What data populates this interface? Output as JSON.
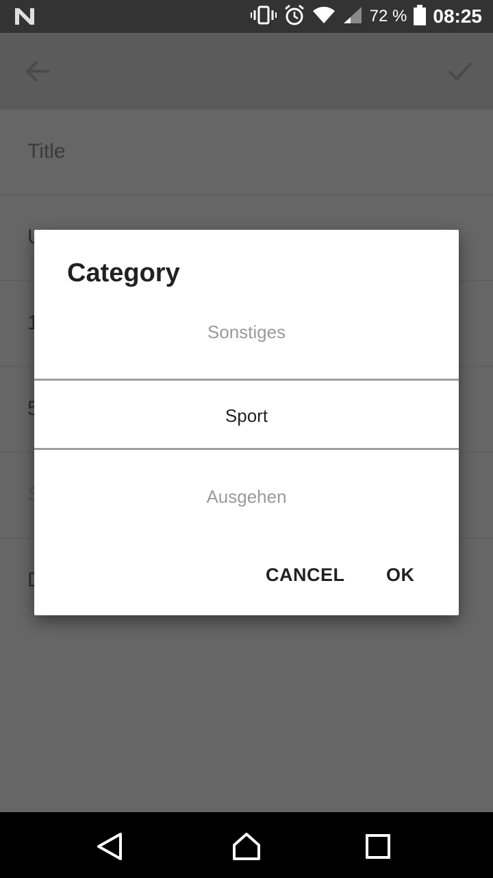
{
  "status_bar": {
    "battery_text": "72 %",
    "time": "08:25",
    "icons": [
      "n-logo-icon",
      "vibrate-icon",
      "alarm-icon",
      "wifi-icon",
      "signal-icon",
      "battery-icon"
    ]
  },
  "toolbar": {
    "back_icon": "arrow-back-icon",
    "confirm_icon": "check-icon"
  },
  "form": {
    "title_placeholder": "Title",
    "row2_partial": "U",
    "row3_partial": "1",
    "row4_partial": "5",
    "row5_partial": "S",
    "row6_partial": "D"
  },
  "dialog": {
    "title": "Category",
    "picker": {
      "previous": "Sonstiges",
      "selected": "Sport",
      "next": "Ausgehen"
    },
    "buttons": {
      "cancel": "CANCEL",
      "ok": "OK"
    }
  },
  "nav_bar": {
    "icons": [
      "back-triangle-icon",
      "home-icon",
      "recents-icon"
    ]
  },
  "colors": {
    "scrim": "#666666",
    "status_bar": "#333333",
    "dialog_bg": "#ffffff",
    "primary_text": "#212121",
    "secondary_text": "#9a9a9a",
    "divider": "#9e9e9e"
  }
}
